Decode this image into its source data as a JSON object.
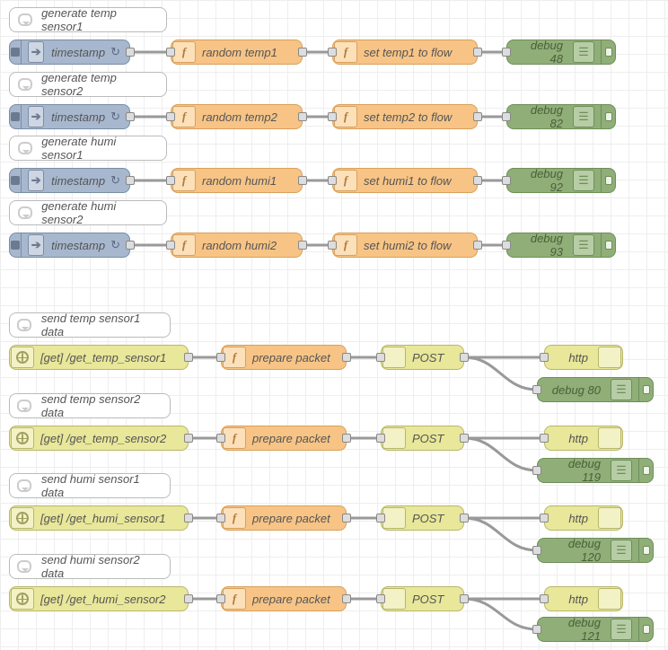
{
  "comments": {
    "gen_t1": "generate temp sensor1",
    "gen_t2": "generate temp sensor2",
    "gen_h1": "generate humi sensor1",
    "gen_h2": "generate humi sensor2",
    "send_t1": "send temp sensor1 data",
    "send_t2": "send temp sensor2 data",
    "send_h1": "send humi sensor1 data",
    "send_h2": "send humi sensor2 data"
  },
  "inject": {
    "label": "timestamp",
    "repeat": "↻"
  },
  "func": {
    "rt1": "random temp1",
    "rt2": "random temp2",
    "rh1": "random humi1",
    "rh2": "random humi2",
    "st1": "set temp1 to flow",
    "st2": "set temp2 to flow",
    "sh1": "set humi1 to flow",
    "sh2": "set humi2 to flow",
    "pp": "prepare packet"
  },
  "debug": {
    "d48": "debug 48",
    "d82": "debug 82",
    "d92": "debug 92",
    "d93": "debug 93",
    "d80": "debug 80",
    "d119": "debug 119",
    "d120": "debug 120",
    "d121": "debug 121"
  },
  "httpin": {
    "t1": "[get] /get_temp_sensor1",
    "t2": "[get] /get_temp_sensor2",
    "h1": "[get] /get_humi_sensor1",
    "h2": "[get] /get_humi_sensor2"
  },
  "httpreq": {
    "label": "POST"
  },
  "httpres": {
    "label": "http"
  }
}
